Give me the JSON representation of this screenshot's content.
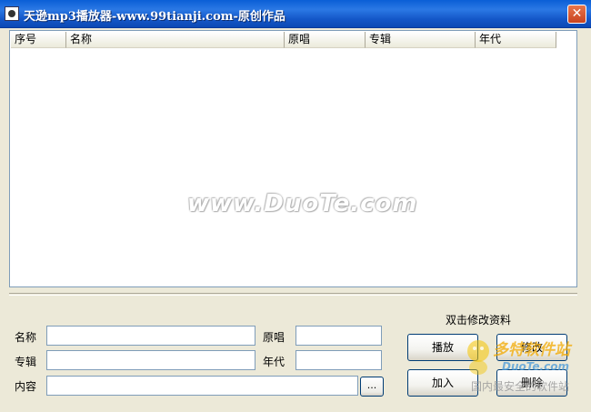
{
  "window": {
    "title": "天逊mp3播放器-www.99tianji.com-原创作品",
    "close_glyph": "✕"
  },
  "list": {
    "columns": [
      "序号",
      "名称",
      "原唱",
      "专辑",
      "年代"
    ],
    "rows": [],
    "watermark": "www.DuoTe.com"
  },
  "form": {
    "name_label": "名称",
    "name_value": "",
    "singer_label": "原唱",
    "singer_value": "",
    "album_label": "专辑",
    "album_value": "",
    "year_label": "年代",
    "year_value": "",
    "content_label": "内容",
    "content_value": "",
    "browse_label": "...",
    "hint": "双击修改资料"
  },
  "buttons": {
    "play": "播放",
    "modify": "修改",
    "add": "加入",
    "delete": "删除"
  },
  "overlay": {
    "brand": "多特软件站",
    "url": "DuoTe.com",
    "tagline": "国内最安全的软件站"
  }
}
